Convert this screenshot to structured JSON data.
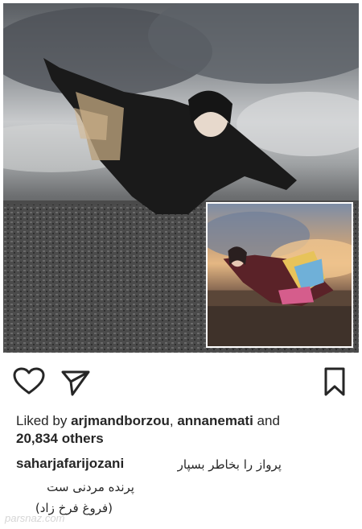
{
  "post": {
    "image_alt_main": "",
    "inset_alt": ""
  },
  "actions": {
    "like": "heart-icon",
    "share": "send-icon",
    "save": "bookmark-icon"
  },
  "likes": {
    "prefix": "Liked by",
    "user1": "arjmandborzou",
    "separator": ",",
    "user2": "annanemati",
    "and": "and",
    "count": "20,834 others"
  },
  "caption": {
    "username": "saharjafarijozani",
    "line1": "پرواز را بخاطر بسپار",
    "line2": "پرنده مردنی ست",
    "line3": "(فروغ فرخ زاد)"
  },
  "watermark": "parsnaz.com"
}
